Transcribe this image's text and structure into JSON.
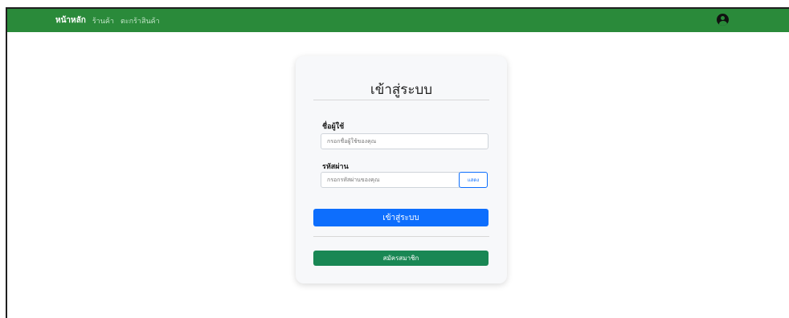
{
  "nav": {
    "brand": "หน้าหลัก",
    "links": [
      "ร้านค้า",
      "ตะกร้าสินค้า"
    ],
    "user_icon": "user-circle-icon",
    "color": "#2a8a3a"
  },
  "login": {
    "title": "เข้าสู่ระบบ",
    "username": {
      "label": "ชื่อผู้ใช้",
      "placeholder": "กรอกชื่อผู้ใช้ของคุณ"
    },
    "password": {
      "label": "รหัสผ่าน",
      "placeholder": "กรอกรหัสผ่านของคุณ",
      "toggle_label": "แสดง"
    },
    "submit_label": "เข้าสู่ระบบ",
    "register_label": "สมัครสมาชิก"
  },
  "colors": {
    "primary": "#0d6efd",
    "success": "#198754"
  }
}
